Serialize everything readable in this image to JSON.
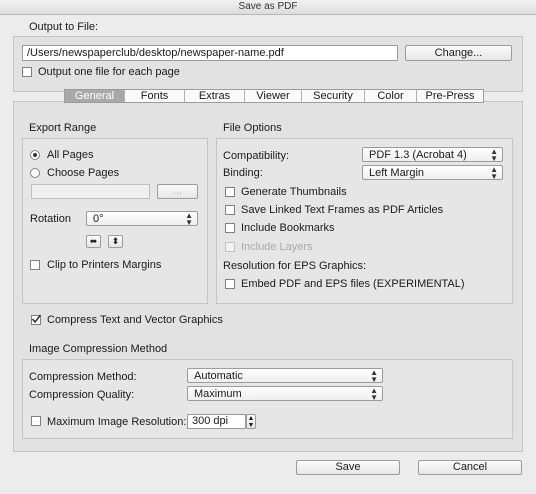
{
  "window": {
    "title": "Save as PDF"
  },
  "output": {
    "heading": "Output to File:",
    "path": "/Users/newspaperclub/desktop/newspaper-name.pdf",
    "change_label": "Change...",
    "one_file_label": "Output one file for each page"
  },
  "tabs": [
    {
      "label": "General",
      "active": true
    },
    {
      "label": "Fonts"
    },
    {
      "label": "Extras"
    },
    {
      "label": "Viewer"
    },
    {
      "label": "Security"
    },
    {
      "label": "Color"
    },
    {
      "label": "Pre-Press"
    }
  ],
  "export_range": {
    "heading": "Export Range",
    "all_pages": "All Pages",
    "choose_pages": "Choose Pages",
    "browse_label": "...",
    "rotation_label": "Rotation",
    "rotation_value": "0°",
    "clip_label": "Clip to Printers Margins"
  },
  "file_options": {
    "heading": "File Options",
    "compatibility_label": "Compatibility:",
    "compatibility_value": "PDF 1.3 (Acrobat 4)",
    "binding_label": "Binding:",
    "binding_value": "Left Margin",
    "thumbnails": "Generate Thumbnails",
    "linked_frames": "Save Linked Text Frames as PDF Articles",
    "bookmarks": "Include Bookmarks",
    "layers": "Include Layers",
    "eps_heading": "Resolution for EPS Graphics:",
    "embed_eps": "Embed PDF and EPS files (EXPERIMENTAL)"
  },
  "compress_text": {
    "label": "Compress Text and Vector Graphics",
    "checked": true
  },
  "image_compression": {
    "heading": "Image Compression Method",
    "method_label": "Compression Method:",
    "method_value": "Automatic",
    "quality_label": "Compression Quality:",
    "quality_value": "Maximum",
    "max_res_label": "Maximum Image Resolution:",
    "max_res_value": "300 dpi"
  },
  "footer": {
    "save_label": "Save",
    "cancel_label": "Cancel"
  }
}
